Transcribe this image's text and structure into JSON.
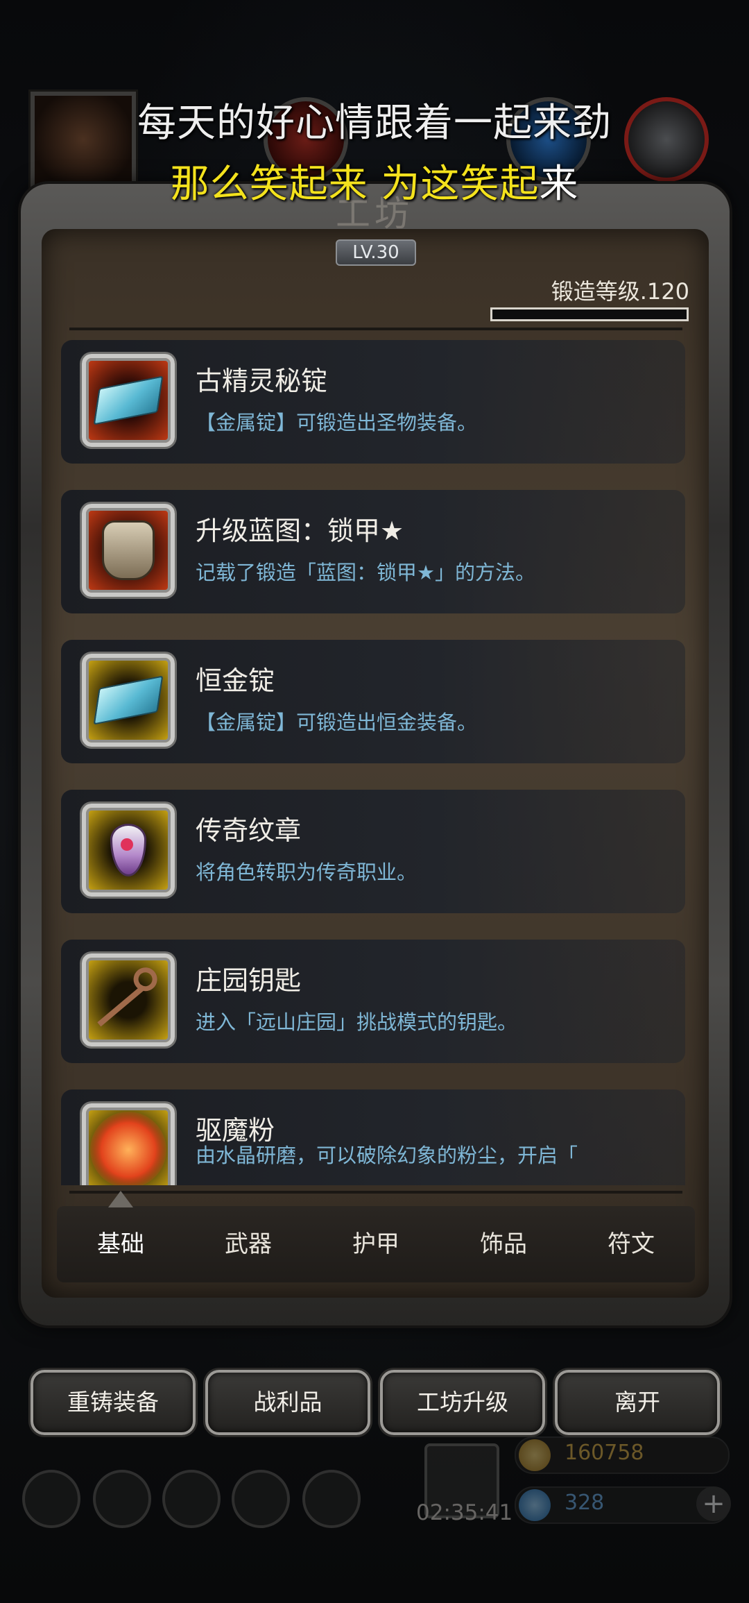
{
  "captions": {
    "line1": "每天的好心情跟着一起来劲",
    "line2_highlight": "那么笑起来 为这笑起",
    "line2_rest": "来"
  },
  "panel": {
    "title": "工坊",
    "level_badge": "LV.30",
    "forge_level": "锻造等级.120",
    "forge_progress": 0.0
  },
  "items": [
    {
      "name": "古精灵秘锭",
      "desc": "【金属锭】可锻造出圣物装备。",
      "icon": "ingot-icon",
      "frame": "red"
    },
    {
      "name": "升级蓝图：锁甲★",
      "desc": "记载了锻造「蓝图：锁甲★」的方法。",
      "icon": "chainmail-armor-icon",
      "frame": "red"
    },
    {
      "name": "恒金锭",
      "desc": "【金属锭】可锻造出恒金装备。",
      "icon": "ingot-icon",
      "frame": "gold"
    },
    {
      "name": "传奇纹章",
      "desc": "将角色转职为传奇职业。",
      "icon": "emblem-icon",
      "frame": "gold"
    },
    {
      "name": "庄园钥匙",
      "desc": "进入「远山庄园」挑战模式的钥匙。",
      "icon": "key-icon",
      "frame": "gold"
    },
    {
      "name": "驱魔粉",
      "desc": "由水晶研磨，可以破除幻象的粉尘，开启「",
      "icon": "fire-dust-icon",
      "frame": "gold"
    }
  ],
  "tabs": [
    {
      "label": "基础",
      "active": true
    },
    {
      "label": "武器",
      "active": false
    },
    {
      "label": "护甲",
      "active": false
    },
    {
      "label": "饰品",
      "active": false
    },
    {
      "label": "符文",
      "active": false
    }
  ],
  "buttons": {
    "reforge": "重铸装备",
    "loot": "战利品",
    "upgrade": "工坊升级",
    "leave": "离开"
  },
  "hud": {
    "gift_timer": "02:35:41",
    "gold": "160758",
    "gems": "328",
    "plus": "+"
  },
  "colors": {
    "caption_highlight": "#f4e21d",
    "desc_text": "#7fb7d6",
    "frame_red": "#c23a14",
    "frame_gold": "#c9a413"
  }
}
